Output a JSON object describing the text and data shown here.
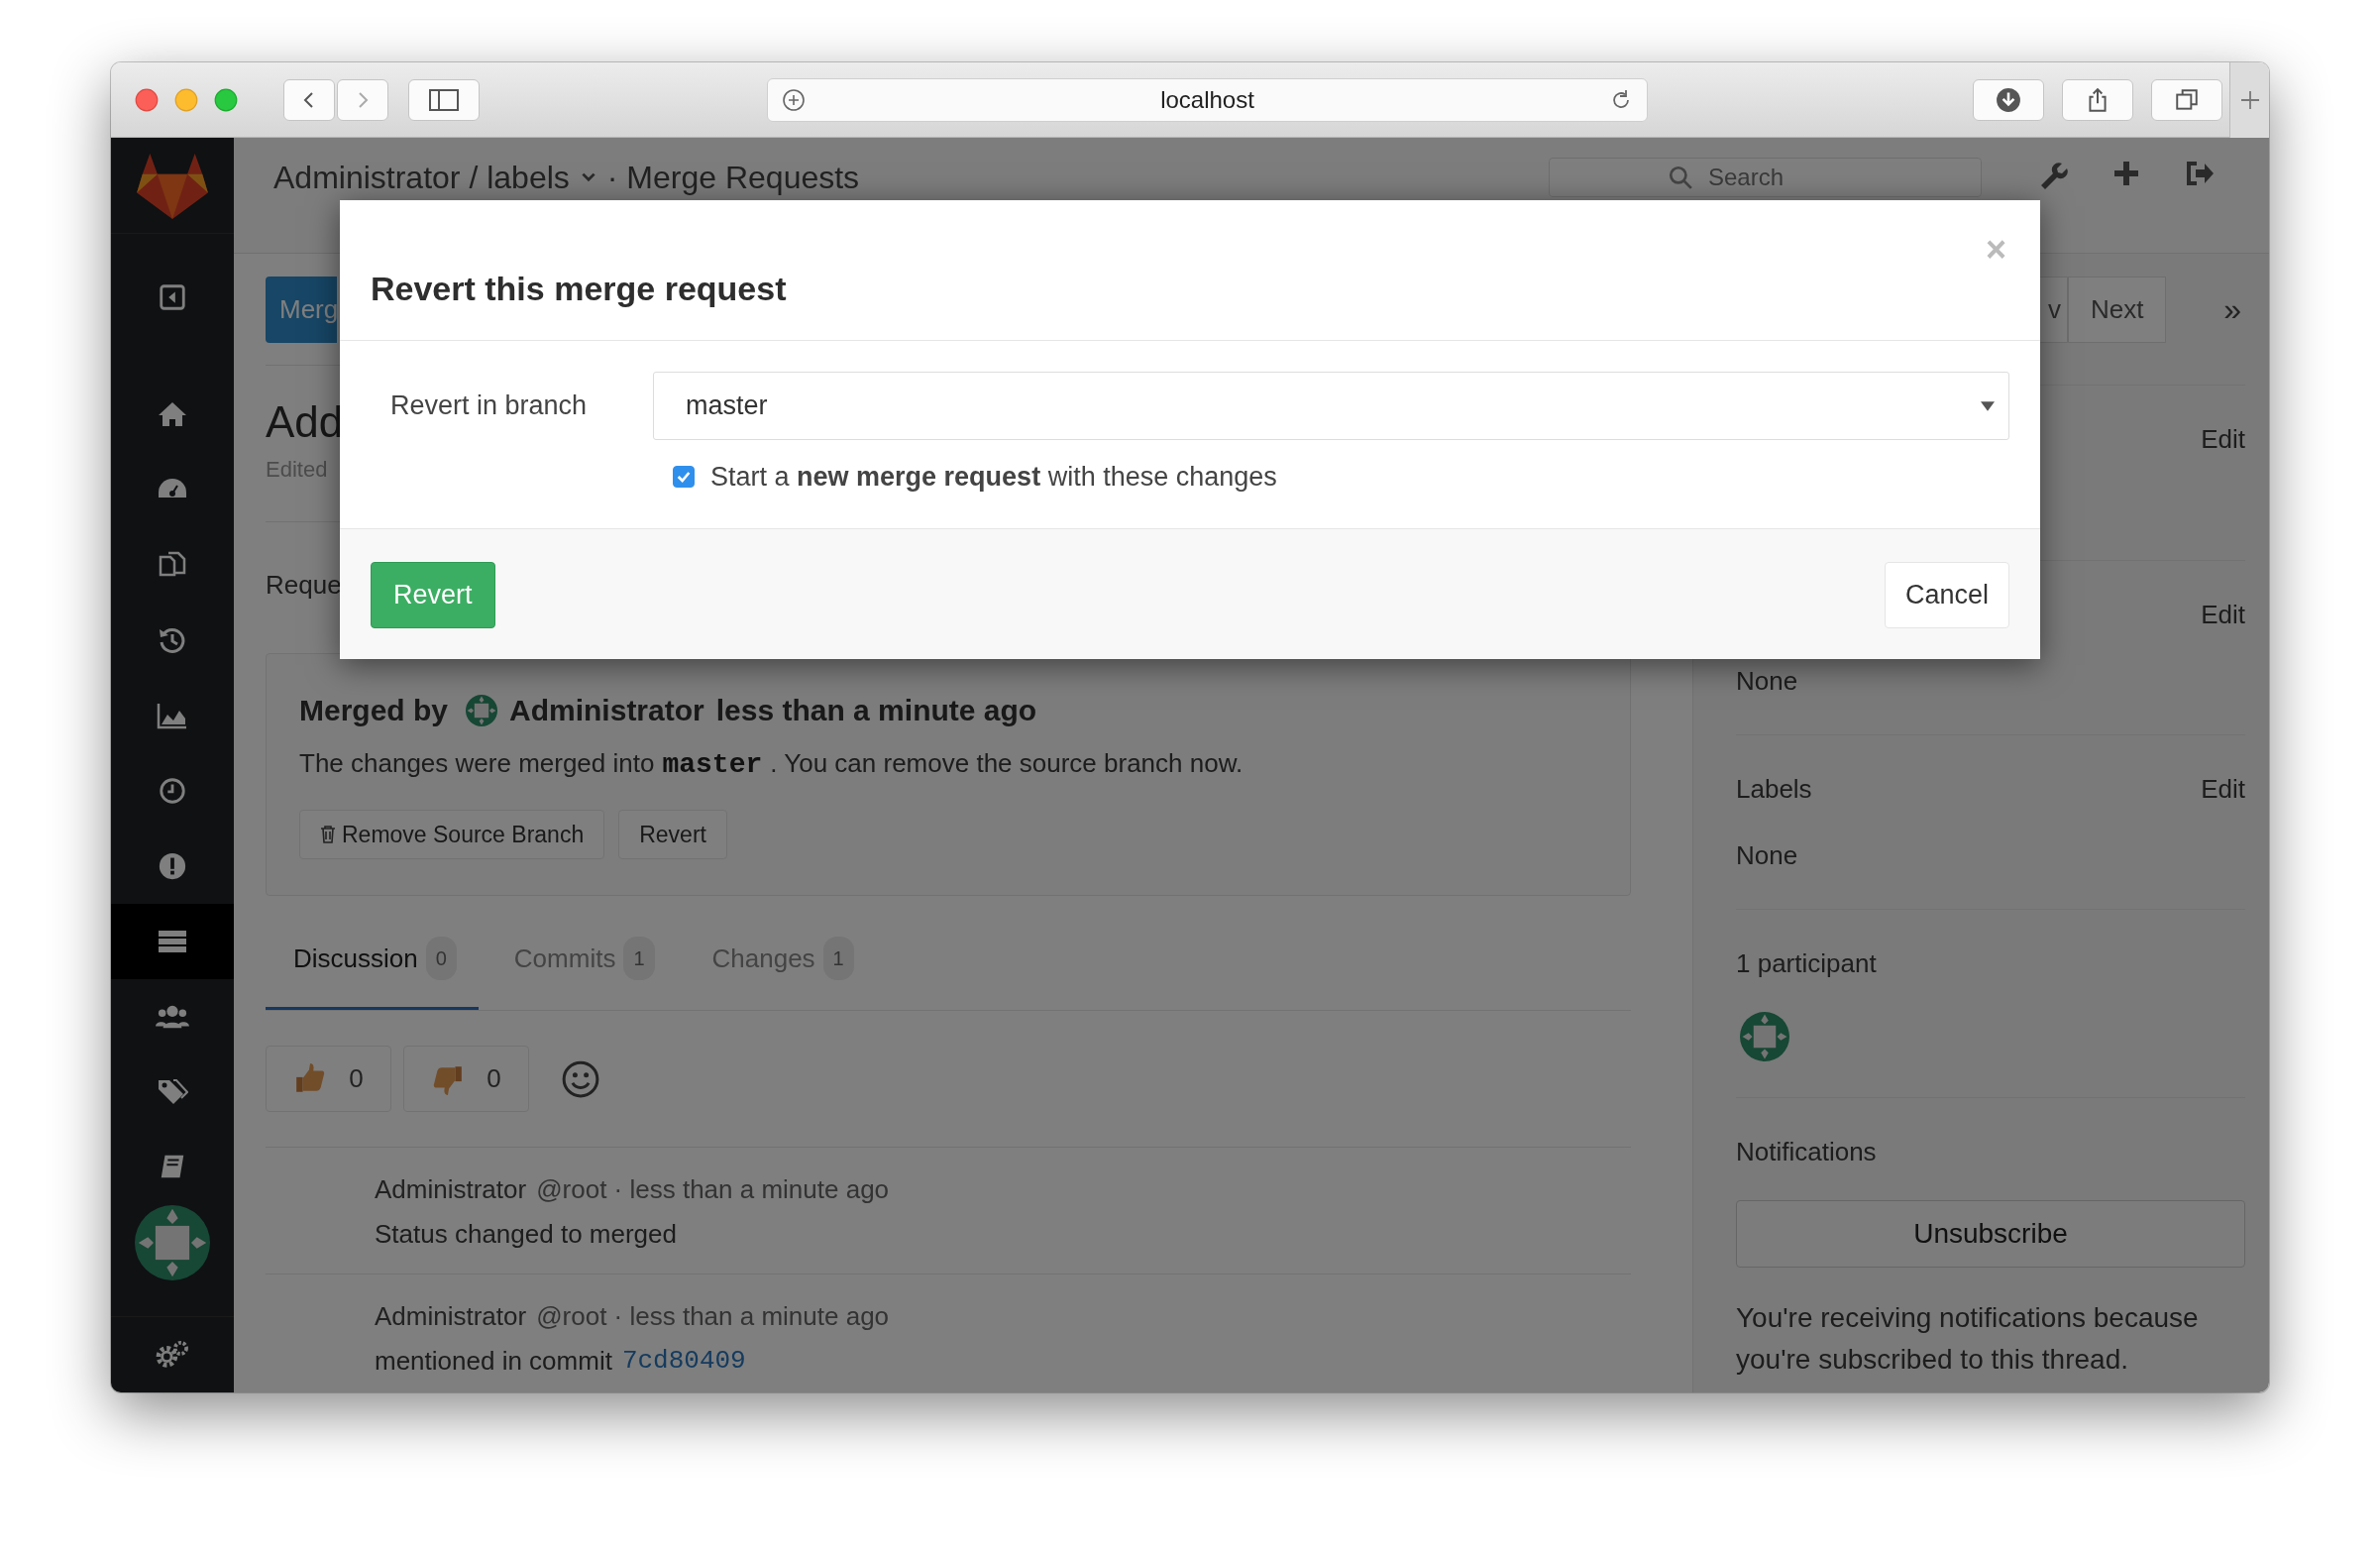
{
  "browser": {
    "url": "localhost"
  },
  "header": {
    "project": "Administrator / labels",
    "page": "· Merge Requests",
    "search": {
      "placeholder": "Search"
    }
  },
  "sidebar": {
    "items": [
      {
        "kind": "back",
        "selected": false
      },
      {
        "kind": "home",
        "selected": false
      },
      {
        "kind": "dashboard",
        "selected": false
      },
      {
        "kind": "files",
        "selected": false
      },
      {
        "kind": "history",
        "selected": false
      },
      {
        "kind": "graph",
        "selected": false
      },
      {
        "kind": "clock",
        "selected": false
      },
      {
        "kind": "alert",
        "selected": false
      },
      {
        "kind": "list",
        "selected": true
      },
      {
        "kind": "users",
        "selected": false
      },
      {
        "kind": "tags",
        "selected": false
      },
      {
        "kind": "book",
        "selected": false
      },
      {
        "kind": "avatar",
        "selected": false
      },
      {
        "kind": "settings",
        "selected": false
      }
    ]
  },
  "toolbar": {
    "new_button": "Merg",
    "prev_button": "v",
    "next_button": "Next",
    "expand": "»"
  },
  "issue": {
    "title": "Add",
    "edited": "Edited",
    "section": "Reque"
  },
  "merged": {
    "prefix": "Merged by",
    "author": "Administrator",
    "time": "less than a minute ago",
    "message_before": "The changes were merged into",
    "branch": "master",
    "message_after": ". You can remove the source branch now.",
    "buttons": [
      {
        "kind": "remove",
        "label": "Remove Source Branch"
      },
      {
        "kind": "plain",
        "label": "Revert"
      }
    ]
  },
  "tabs": [
    {
      "label": "Discussion",
      "count": "0",
      "selected": true
    },
    {
      "label": "Commits",
      "count": "1",
      "selected": false
    },
    {
      "label": "Changes",
      "count": "1",
      "selected": false
    }
  ],
  "awards": [
    {
      "kind": "thumbsup",
      "count": "0"
    },
    {
      "kind": "thumbsdown",
      "count": "0"
    }
  ],
  "notes": [
    {
      "author": "Administrator",
      "meta": "@root · less than a minute ago",
      "body": "Status changed to merged"
    },
    {
      "author": "Administrator",
      "meta": "@root · less than a minute ago",
      "body": "mentioned in commit",
      "commit": "7cd80409"
    }
  ],
  "right_sidebar": {
    "sections": [
      {
        "kind": "edit_only",
        "edit": "Edit"
      },
      {
        "kind": "value",
        "edit": "Edit",
        "value": "None"
      },
      {
        "kind": "value",
        "label": "Labels",
        "edit": "Edit",
        "value": "None"
      },
      {
        "kind": "participants",
        "label": "1 participant"
      },
      {
        "kind": "notifications",
        "label": "Notifications",
        "button": "Unsubscribe",
        "note": "You're receiving notifications because you're subscribed to this thread."
      }
    ]
  },
  "modal": {
    "title": "Revert this merge request",
    "close": "×",
    "field_label": "Revert in branch",
    "branch": "master",
    "checkbox": {
      "checked": true,
      "text": "Start a **new merge request** with these changes"
    },
    "submit": "Revert",
    "cancel": "Cancel"
  }
}
